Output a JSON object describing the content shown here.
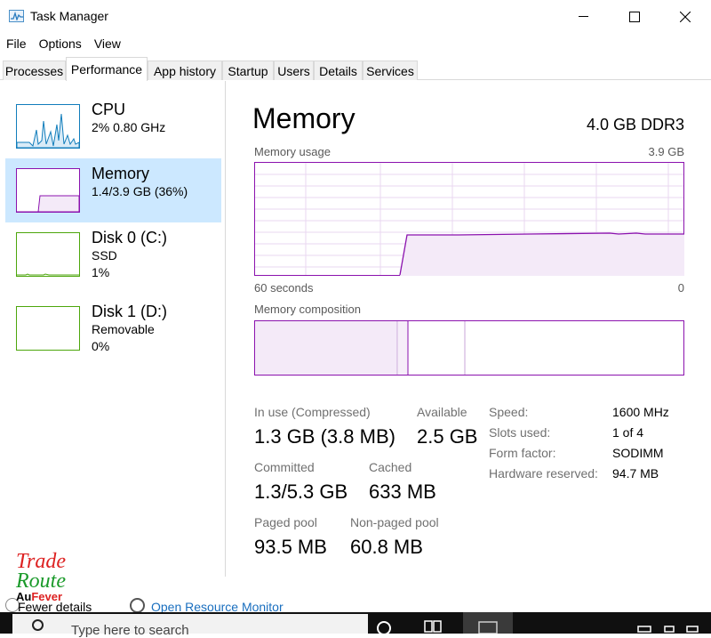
{
  "window": {
    "title": "Task Manager"
  },
  "menu": [
    "File",
    "Options",
    "View"
  ],
  "tabs": [
    "Processes",
    "Performance",
    "App history",
    "Startup",
    "Users",
    "Details",
    "Services"
  ],
  "active_tab": "Performance",
  "sidebar": {
    "items": [
      {
        "title": "CPU",
        "line1": "2%  0.80 GHz",
        "line2": "",
        "color": "#117dbb"
      },
      {
        "title": "Memory",
        "line1": "1.4/3.9 GB (36%)",
        "line2": "",
        "color": "#8b12ae",
        "selected": true
      },
      {
        "title": "Disk 0 (C:)",
        "line1": "SSD",
        "line2": "1%",
        "color": "#4da60c"
      },
      {
        "title": "Disk 1 (D:)",
        "line1": "Removable",
        "line2": "0%",
        "color": "#4da60c"
      }
    ]
  },
  "main": {
    "title": "Memory",
    "spec": "4.0 GB DDR3",
    "usage_label": "Memory usage",
    "usage_max": "3.9 GB",
    "time_left": "60 seconds",
    "time_right": "0",
    "composition_label": "Memory composition",
    "accent": "#8b12ae",
    "stats": {
      "in_use_label": "In use (Compressed)",
      "in_use_value": "1.3 GB (3.8 MB)",
      "available_label": "Available",
      "available_value": "2.5 GB",
      "committed_label": "Committed",
      "committed_value": "1.3/5.3 GB",
      "cached_label": "Cached",
      "cached_value": "633 MB",
      "paged_label": "Paged pool",
      "paged_value": "93.5 MB",
      "nonpaged_label": "Non-paged pool",
      "nonpaged_value": "60.8 MB"
    },
    "specs": [
      {
        "label": "Speed:",
        "value": "1600 MHz"
      },
      {
        "label": "Slots used:",
        "value": "1 of 4"
      },
      {
        "label": "Form factor:",
        "value": "SODIMM"
      },
      {
        "label": "Hardware reserved:",
        "value": "94.7 MB"
      }
    ]
  },
  "bottom": {
    "fewer_details": "Fewer details",
    "open_monitor": "Open Resource Monitor"
  },
  "watermark": {
    "line1": "Trade",
    "line2": "Route",
    "line3": "Au",
    "line4": "Fever"
  },
  "taskbar": {
    "search_placeholder": "Type here to search"
  }
}
